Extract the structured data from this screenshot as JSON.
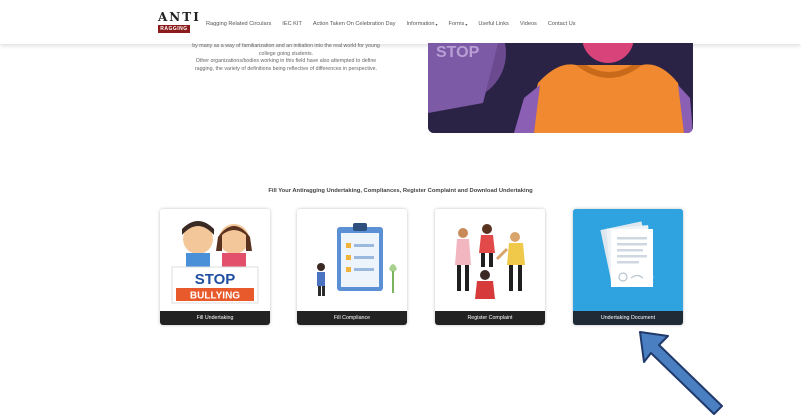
{
  "logo": {
    "top": "ANTI",
    "bar": "RAGGING"
  },
  "nav": {
    "items": [
      {
        "label": "Ragging Related Circulars",
        "caret": false
      },
      {
        "label": "IEC KIT",
        "caret": false
      },
      {
        "label": "Action Taken On Celebration Day",
        "caret": false
      },
      {
        "label": "Information",
        "caret": true
      },
      {
        "label": "Forms",
        "caret": true
      },
      {
        "label": "Useful Links",
        "caret": false
      },
      {
        "label": "Videos",
        "caret": false
      },
      {
        "label": "Contact Us",
        "caret": false
      }
    ]
  },
  "intro": {
    "line1": "by many as a way of familiarization and an initiation into the real world for young",
    "line2": "college going students.",
    "line3": "Other organizations/bodies working in this field have also attempted to define",
    "line4": "ragging, the variety of definitions being reflective of differences in perspective."
  },
  "hero": {
    "sign_text": "STOP"
  },
  "section": {
    "title": "Fill Your Antiragging Undertaking, Compliances, Register Complaint and Download Undertaking"
  },
  "cards": [
    {
      "label": "Fill Undertaking",
      "art_text_1": "STOP",
      "art_text_2": "BULLYING"
    },
    {
      "label": "Fill Compliance"
    },
    {
      "label": "Register Complaint"
    },
    {
      "label": "Undertaking Document"
    }
  ],
  "colors": {
    "accent_blue": "#2ea3e0",
    "arrow_blue": "#4a7fc1",
    "card_label_bg": "#222222"
  }
}
